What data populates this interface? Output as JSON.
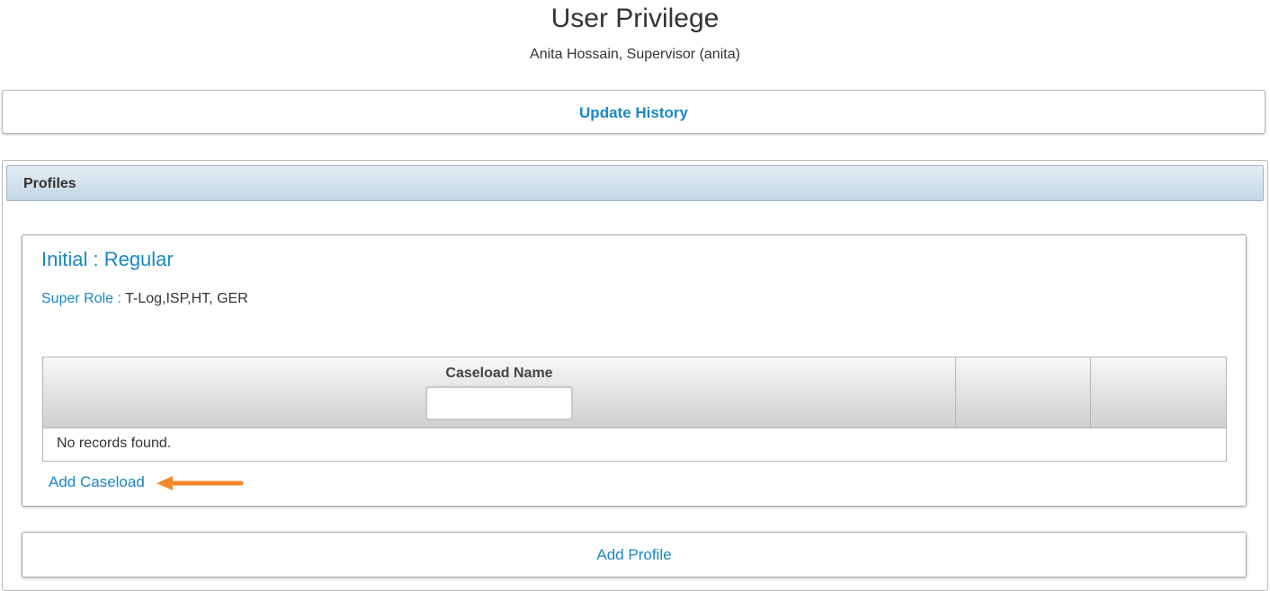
{
  "page": {
    "title": "User Privilege",
    "subtitle": "Anita Hossain, Supervisor (anita)"
  },
  "history": {
    "link_label": "Update History"
  },
  "profiles": {
    "header_label": "Profiles",
    "card": {
      "title": "Initial : Regular",
      "super_role_label": "Super Role : ",
      "super_role_value": "T-Log,ISP,HT, GER",
      "table": {
        "columns": [
          "Caseload Name",
          "",
          ""
        ],
        "filter_value": "",
        "empty_message": "No records found."
      },
      "add_caseload_label": "Add Caseload"
    },
    "add_profile_label": "Add Profile"
  },
  "colors": {
    "link": "#1a87c4",
    "annotation_arrow": "#f28a2a",
    "header_gradient_top": "#e3edf4",
    "header_gradient_bottom": "#c3d7e3"
  },
  "icons": {
    "annotation": "arrow-left-icon"
  }
}
